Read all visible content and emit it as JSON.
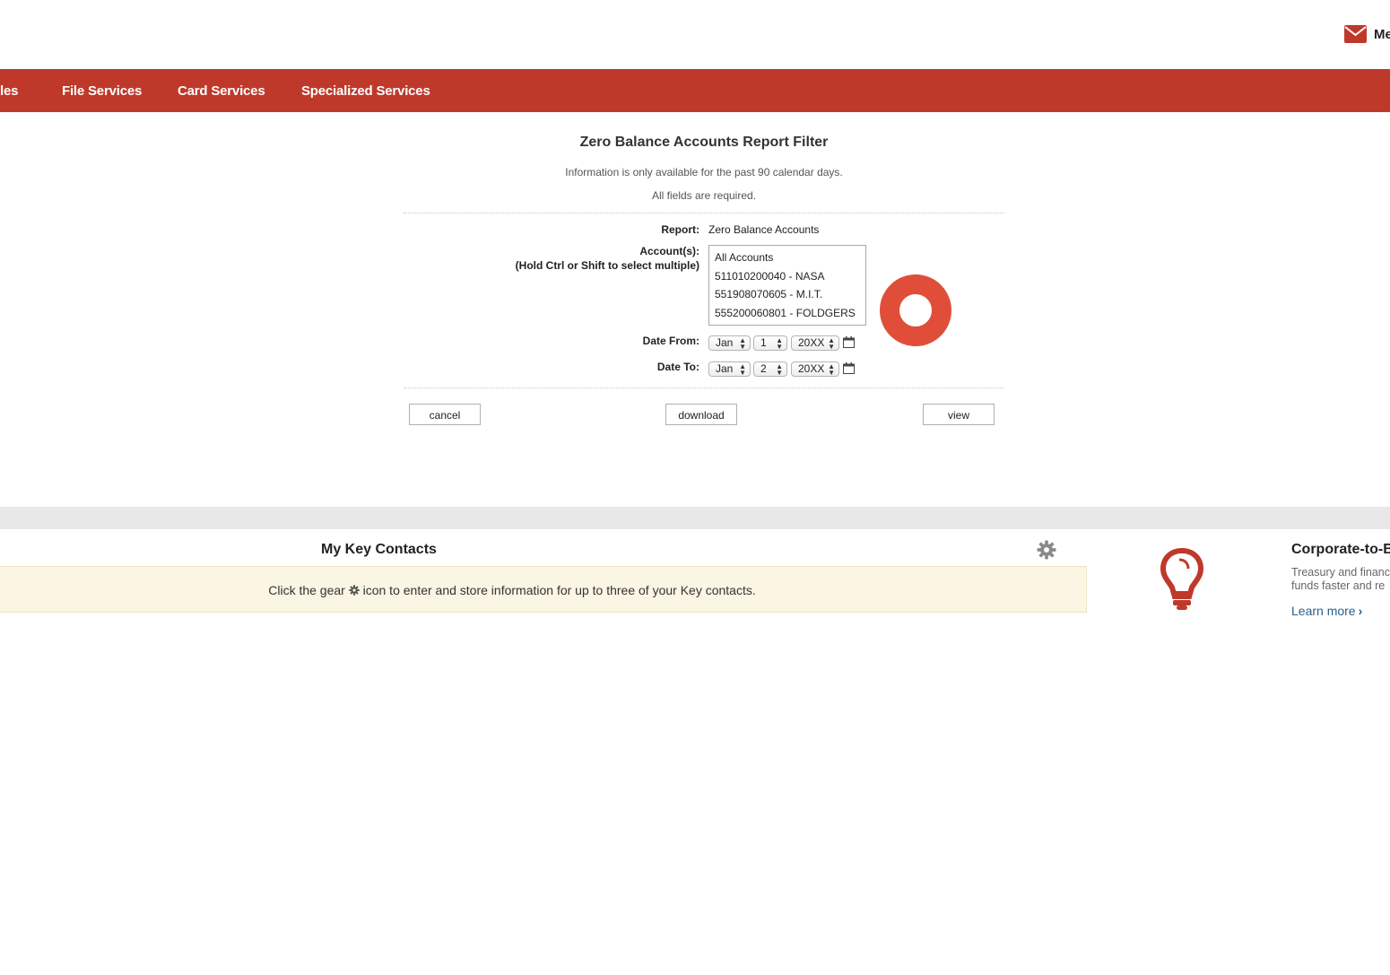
{
  "header": {
    "mail_label": "Me"
  },
  "nav": {
    "items": [
      {
        "label": "les"
      },
      {
        "label": "File Services"
      },
      {
        "label": "Card Services"
      },
      {
        "label": "Specialized Services"
      }
    ]
  },
  "filter": {
    "title": "Zero Balance Accounts Report Filter",
    "info_lines": [
      "Information is only available for the past 90 calendar days.",
      "All fields are required."
    ],
    "report_label": "Report:",
    "report_value": "Zero Balance Accounts",
    "accounts_label": "Account(s):",
    "accounts_hint": "(Hold Ctrl or Shift to select multiple)",
    "accounts": [
      "All Accounts",
      "511010200040 - NASA",
      "551908070605 - M.I.T.",
      "555200060801 - FOLDGERS"
    ],
    "date_from_label": "Date From:",
    "date_from": {
      "month": "Jan",
      "day": "1",
      "year": "20XX"
    },
    "date_to_label": "Date To:",
    "date_to": {
      "month": "Jan",
      "day": "2",
      "year": "20XX"
    },
    "buttons": {
      "cancel": "cancel",
      "download": "download",
      "view": "view"
    }
  },
  "contacts": {
    "title": "My Key Contacts",
    "notice_before": "Click the gear",
    "notice_after": "icon to enter and store information for up to three of your Key contacts."
  },
  "promo": {
    "title": "Corporate-to-B",
    "desc_lines": [
      "Treasury and financ",
      "funds faster and re"
    ],
    "link": "Learn more"
  },
  "colors": {
    "nav_bg": "#bf392b",
    "accent": "#bf392b",
    "spinner": "#e04e39",
    "notice_bg": "#fbf5e3",
    "band": "#e8e8e8",
    "link": "#2b5f8a"
  }
}
